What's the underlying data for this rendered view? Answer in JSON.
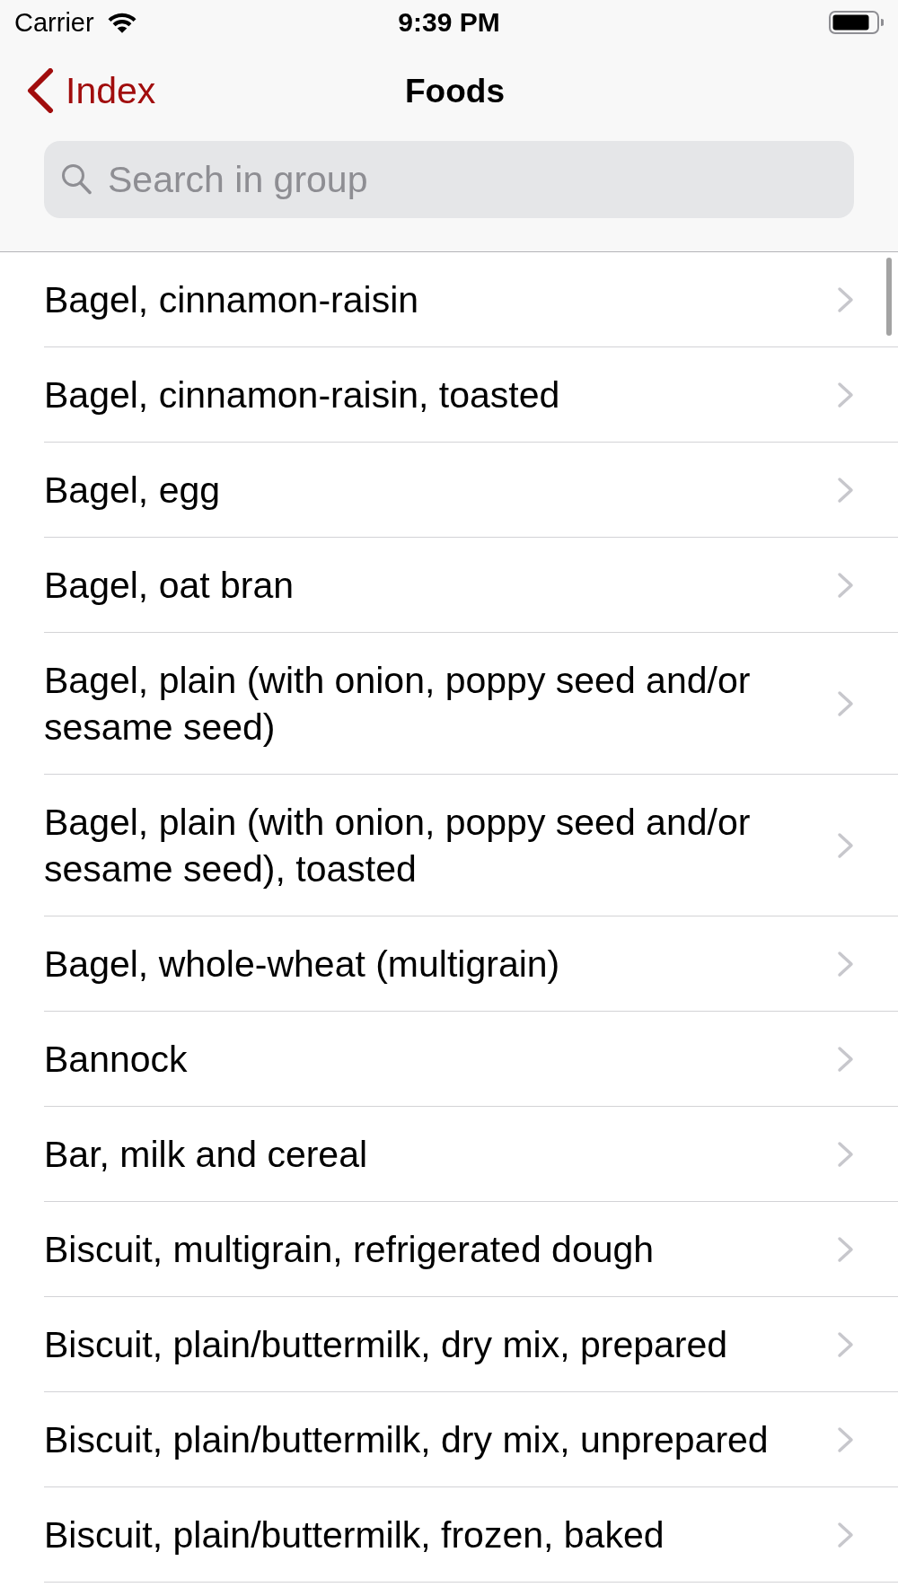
{
  "status_bar": {
    "carrier": "Carrier",
    "time": "9:39 PM"
  },
  "nav_bar": {
    "back_label": "Index",
    "title": "Foods"
  },
  "search": {
    "placeholder": "Search in group"
  },
  "rows": [
    {
      "label": "Bagel, cinnamon-raisin"
    },
    {
      "label": "Bagel, cinnamon-raisin, toasted"
    },
    {
      "label": "Bagel, egg"
    },
    {
      "label": "Bagel, oat bran"
    },
    {
      "label": "Bagel, plain (with onion, poppy seed and/or sesame seed)"
    },
    {
      "label": "Bagel, plain (with onion, poppy seed and/or sesame seed), toasted"
    },
    {
      "label": "Bagel, whole-wheat (multigrain)"
    },
    {
      "label": "Bannock"
    },
    {
      "label": "Bar, milk and cereal"
    },
    {
      "label": "Biscuit, multigrain, refrigerated dough"
    },
    {
      "label": "Biscuit, plain/buttermilk, dry mix, prepared"
    },
    {
      "label": "Biscuit, plain/buttermilk, dry mix, unprepared"
    },
    {
      "label": "Biscuit, plain/buttermilk, frozen, baked"
    }
  ]
}
